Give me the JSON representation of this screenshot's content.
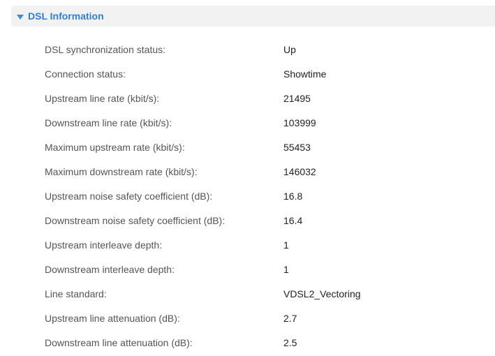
{
  "section": {
    "title": "DSL Information",
    "expanded": true,
    "accent_color": "#2f7fd0",
    "icon": "chevron-down-icon"
  },
  "rows": [
    {
      "label": "DSL synchronization status:",
      "value": "Up"
    },
    {
      "label": "Connection status:",
      "value": "Showtime"
    },
    {
      "label": "Upstream line rate (kbit/s):",
      "value": "21495"
    },
    {
      "label": "Downstream line rate (kbit/s):",
      "value": "103999"
    },
    {
      "label": "Maximum upstream rate (kbit/s):",
      "value": "55453"
    },
    {
      "label": "Maximum downstream rate (kbit/s):",
      "value": "146032"
    },
    {
      "label": "Upstream noise safety coefficient (dB):",
      "value": "16.8"
    },
    {
      "label": "Downstream noise safety coefficient (dB):",
      "value": "16.4"
    },
    {
      "label": "Upstream interleave depth:",
      "value": "1"
    },
    {
      "label": "Downstream interleave depth:",
      "value": "1"
    },
    {
      "label": "Line standard:",
      "value": "VDSL2_Vectoring"
    },
    {
      "label": "Upstream line attenuation (dB):",
      "value": "2.7"
    },
    {
      "label": "Downstream line attenuation (dB):",
      "value": "2.5"
    }
  ]
}
